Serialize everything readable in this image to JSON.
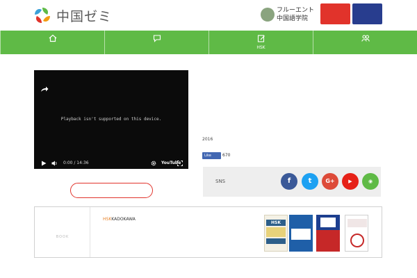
{
  "header": {
    "logo_text": "中国ゼミ",
    "tagline": "",
    "fluent_name_line1": "フルーエント",
    "fluent_name_line2": "中国語学院",
    "btn_red_line1": "",
    "btn_red_line2": "",
    "btn_navy_line1": "",
    "btn_navy_line2": ""
  },
  "nav": {
    "items": [
      {
        "label": "",
        "icon": "home-icon"
      },
      {
        "label": "",
        "icon": "chat-icon"
      },
      {
        "label": "HSK",
        "icon": "edit-icon"
      },
      {
        "label": "",
        "icon": "people-icon"
      }
    ]
  },
  "video": {
    "title": "",
    "message": "Playback isn't supported on this device.",
    "time": "0:00 / 14:36",
    "logo": "YouTube"
  },
  "video_caption": "",
  "cta_label": "",
  "profile": {
    "name": "",
    "line1": "",
    "line2": "",
    "paragraph": "",
    "year_line": "2016",
    "link": "",
    "fb_like": "Like",
    "fb_count": "670"
  },
  "social": {
    "label": "SNS",
    "buttons": [
      {
        "name": "facebook",
        "glyph": "f"
      },
      {
        "name": "twitter",
        "glyph": "t"
      },
      {
        "name": "google-plus",
        "glyph": "G+"
      },
      {
        "name": "youtube",
        "glyph": "▶"
      },
      {
        "name": "rss",
        "glyph": "◉"
      }
    ]
  },
  "books": {
    "label_jp": "",
    "label_en": "BOOK",
    "items": [
      {
        "link": "HSK",
        "rest": "KADOKAWA"
      },
      {
        "link": "",
        "rest": ""
      },
      {
        "link": "",
        "rest": ""
      },
      {
        "link": "",
        "rest": ""
      },
      {
        "link": "",
        "rest": ""
      }
    ],
    "cover1_title": "HSK"
  },
  "colors": {
    "green": "#5fba46",
    "red": "#e1332b",
    "navy": "#283d8e",
    "orange": "#e67e22"
  }
}
